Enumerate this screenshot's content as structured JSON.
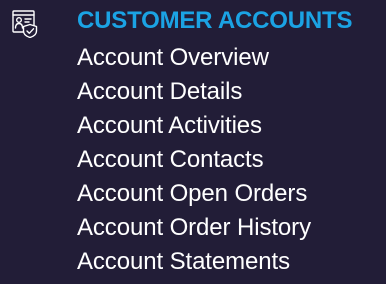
{
  "section": {
    "icon": "account-card-shield-icon",
    "title": "CUSTOMER ACCOUNTS",
    "items": [
      {
        "label": "Account Overview"
      },
      {
        "label": "Account Details"
      },
      {
        "label": "Account Activities"
      },
      {
        "label": "Account Contacts"
      },
      {
        "label": "Account Open Orders"
      },
      {
        "label": "Account Order History"
      },
      {
        "label": "Account Statements"
      }
    ]
  },
  "colors": {
    "background": "#221d37",
    "title": "#1ba3e4",
    "item_text": "#ffffff",
    "icon_stroke": "#ffffff"
  }
}
